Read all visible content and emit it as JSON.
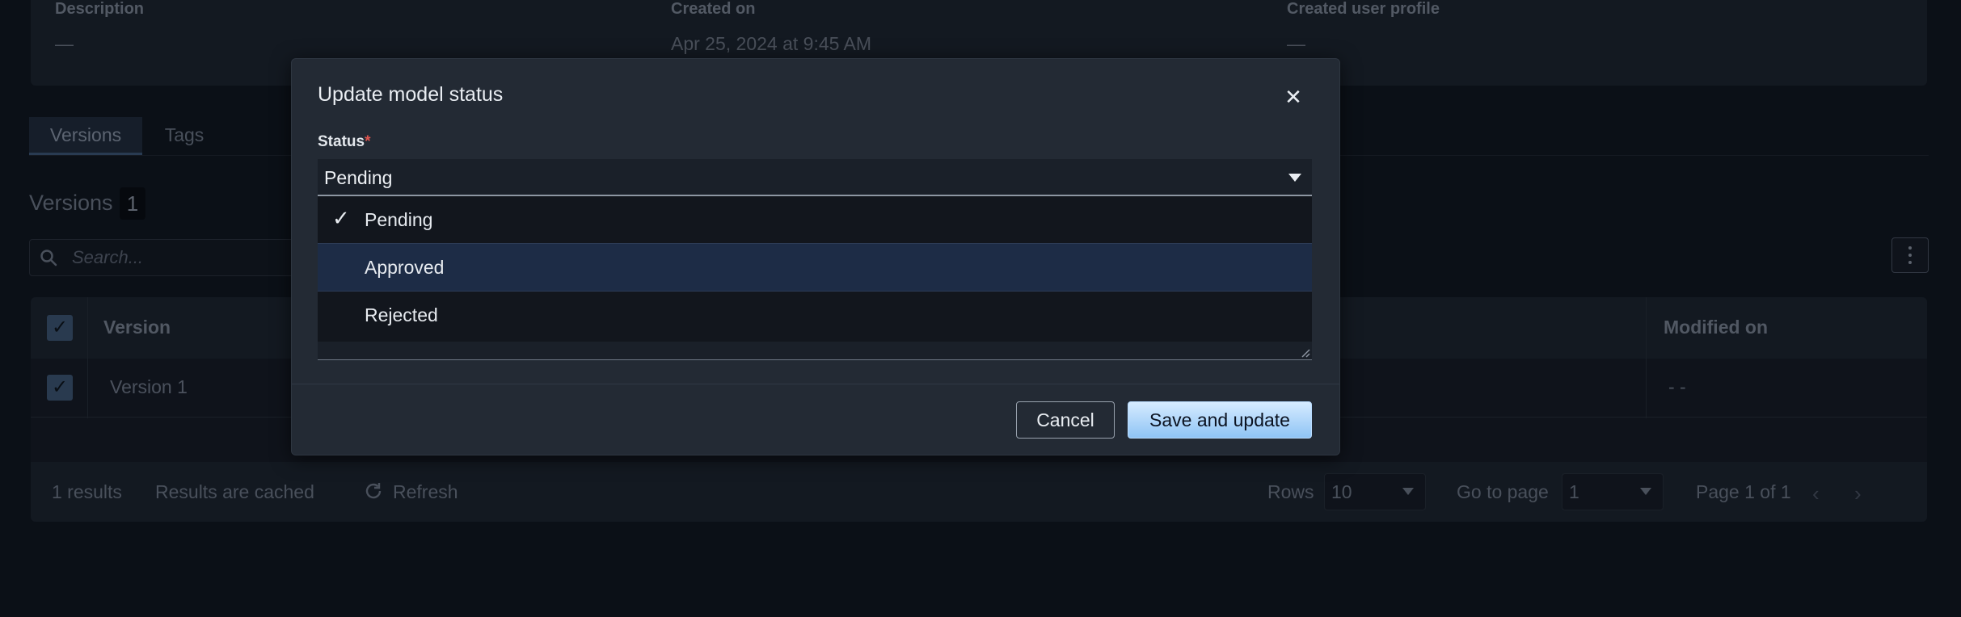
{
  "details": {
    "description_label": "Description",
    "description_value": "—",
    "created_on_label": "Created on",
    "created_on_value": "Apr 25, 2024 at 9:45 AM",
    "created_by_label": "Created user profile",
    "created_by_value": "—"
  },
  "tabs": [
    {
      "label": "Versions",
      "active": true
    },
    {
      "label": "Tags",
      "active": false
    }
  ],
  "versions": {
    "title": "Versions",
    "count": "1",
    "search_placeholder": "Search...",
    "columns": [
      "Version",
      "Modified on"
    ],
    "rows": [
      {
        "version": "Version 1",
        "modified_on": "- -",
        "selected": true
      }
    ],
    "footer": {
      "results": "1 results",
      "cached": "Results are cached",
      "refresh": "Refresh",
      "rows_label": "Rows",
      "rows_value": "10",
      "goto_label": "Go to page",
      "goto_value": "1",
      "page_info": "Page 1 of 1"
    }
  },
  "modal": {
    "title": "Update model status",
    "close_symbol": "✕",
    "status_label": "Status",
    "required_mark": "*",
    "selected_value": "Pending",
    "options": [
      {
        "label": "Pending",
        "checked": true
      },
      {
        "label": "Approved",
        "checked": false,
        "highlighted": true
      },
      {
        "label": "Rejected",
        "checked": false
      }
    ],
    "check_symbol": "✓",
    "cancel_label": "Cancel",
    "save_label": "Save and update"
  },
  "symbols": {
    "checkbox_mark": "✓",
    "prev_page": "‹",
    "next_page": "›"
  },
  "colors": {
    "accent_blue": "#8fc4f5",
    "highlight_option": "#1d2c46",
    "required_red": "#e0554e"
  },
  "icons": [
    "search-icon",
    "refresh-icon",
    "kebab-menu-icon",
    "close-icon",
    "checkmark-icon",
    "chevron-down-icon",
    "chevron-left-icon",
    "chevron-right-icon",
    "resize-handle-icon"
  ]
}
